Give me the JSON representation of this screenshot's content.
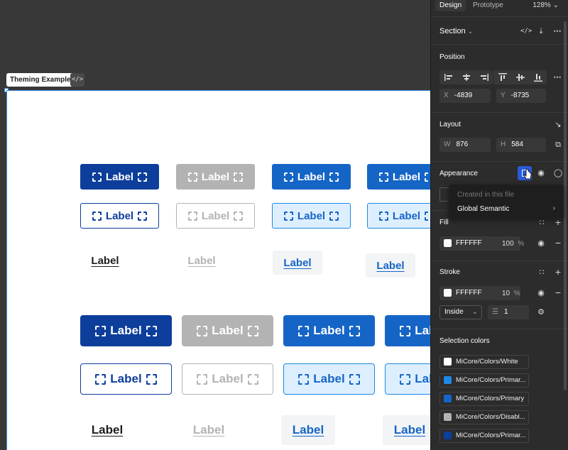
{
  "canvas": {
    "frame_label": "Theming Example",
    "code_icon": "code-icon",
    "button_label": "Label"
  },
  "panel": {
    "tabs": {
      "design": "Design",
      "prototype": "Prototype"
    },
    "zoom": "128%",
    "section": {
      "label": "Section"
    },
    "position": {
      "title": "Position",
      "x_label": "X",
      "x_value": "-4839",
      "y_label": "Y",
      "y_value": "-8735"
    },
    "layout": {
      "title": "Layout",
      "w_label": "W",
      "w_value": "876",
      "h_label": "H",
      "h_value": "584"
    },
    "appearance": {
      "title": "Appearance"
    },
    "fill": {
      "title": "Fill",
      "hex": "FFFFFF",
      "opacity": "100",
      "unit": "%"
    },
    "stroke": {
      "title": "Stroke",
      "hex": "FFFFFF",
      "opacity": "10",
      "unit": "%",
      "position": "Inside",
      "weight": "1"
    },
    "selection_colors": {
      "title": "Selection colors",
      "items": [
        {
          "name": "MiCore/Colors/White",
          "color": "#ffffff"
        },
        {
          "name": "MiCore/Colors/Primar...",
          "color": "#1e88e5"
        },
        {
          "name": "MiCore/Colors/Primary",
          "color": "#1565c7"
        },
        {
          "name": "MiCore/Colors/Disabl...",
          "color": "#b3b3b3"
        },
        {
          "name": "MiCore/Colors/Primar...",
          "color": "#0d3e9c"
        }
      ]
    },
    "dropdown": {
      "header": "Created in this file",
      "item": "Global Semantic"
    }
  }
}
